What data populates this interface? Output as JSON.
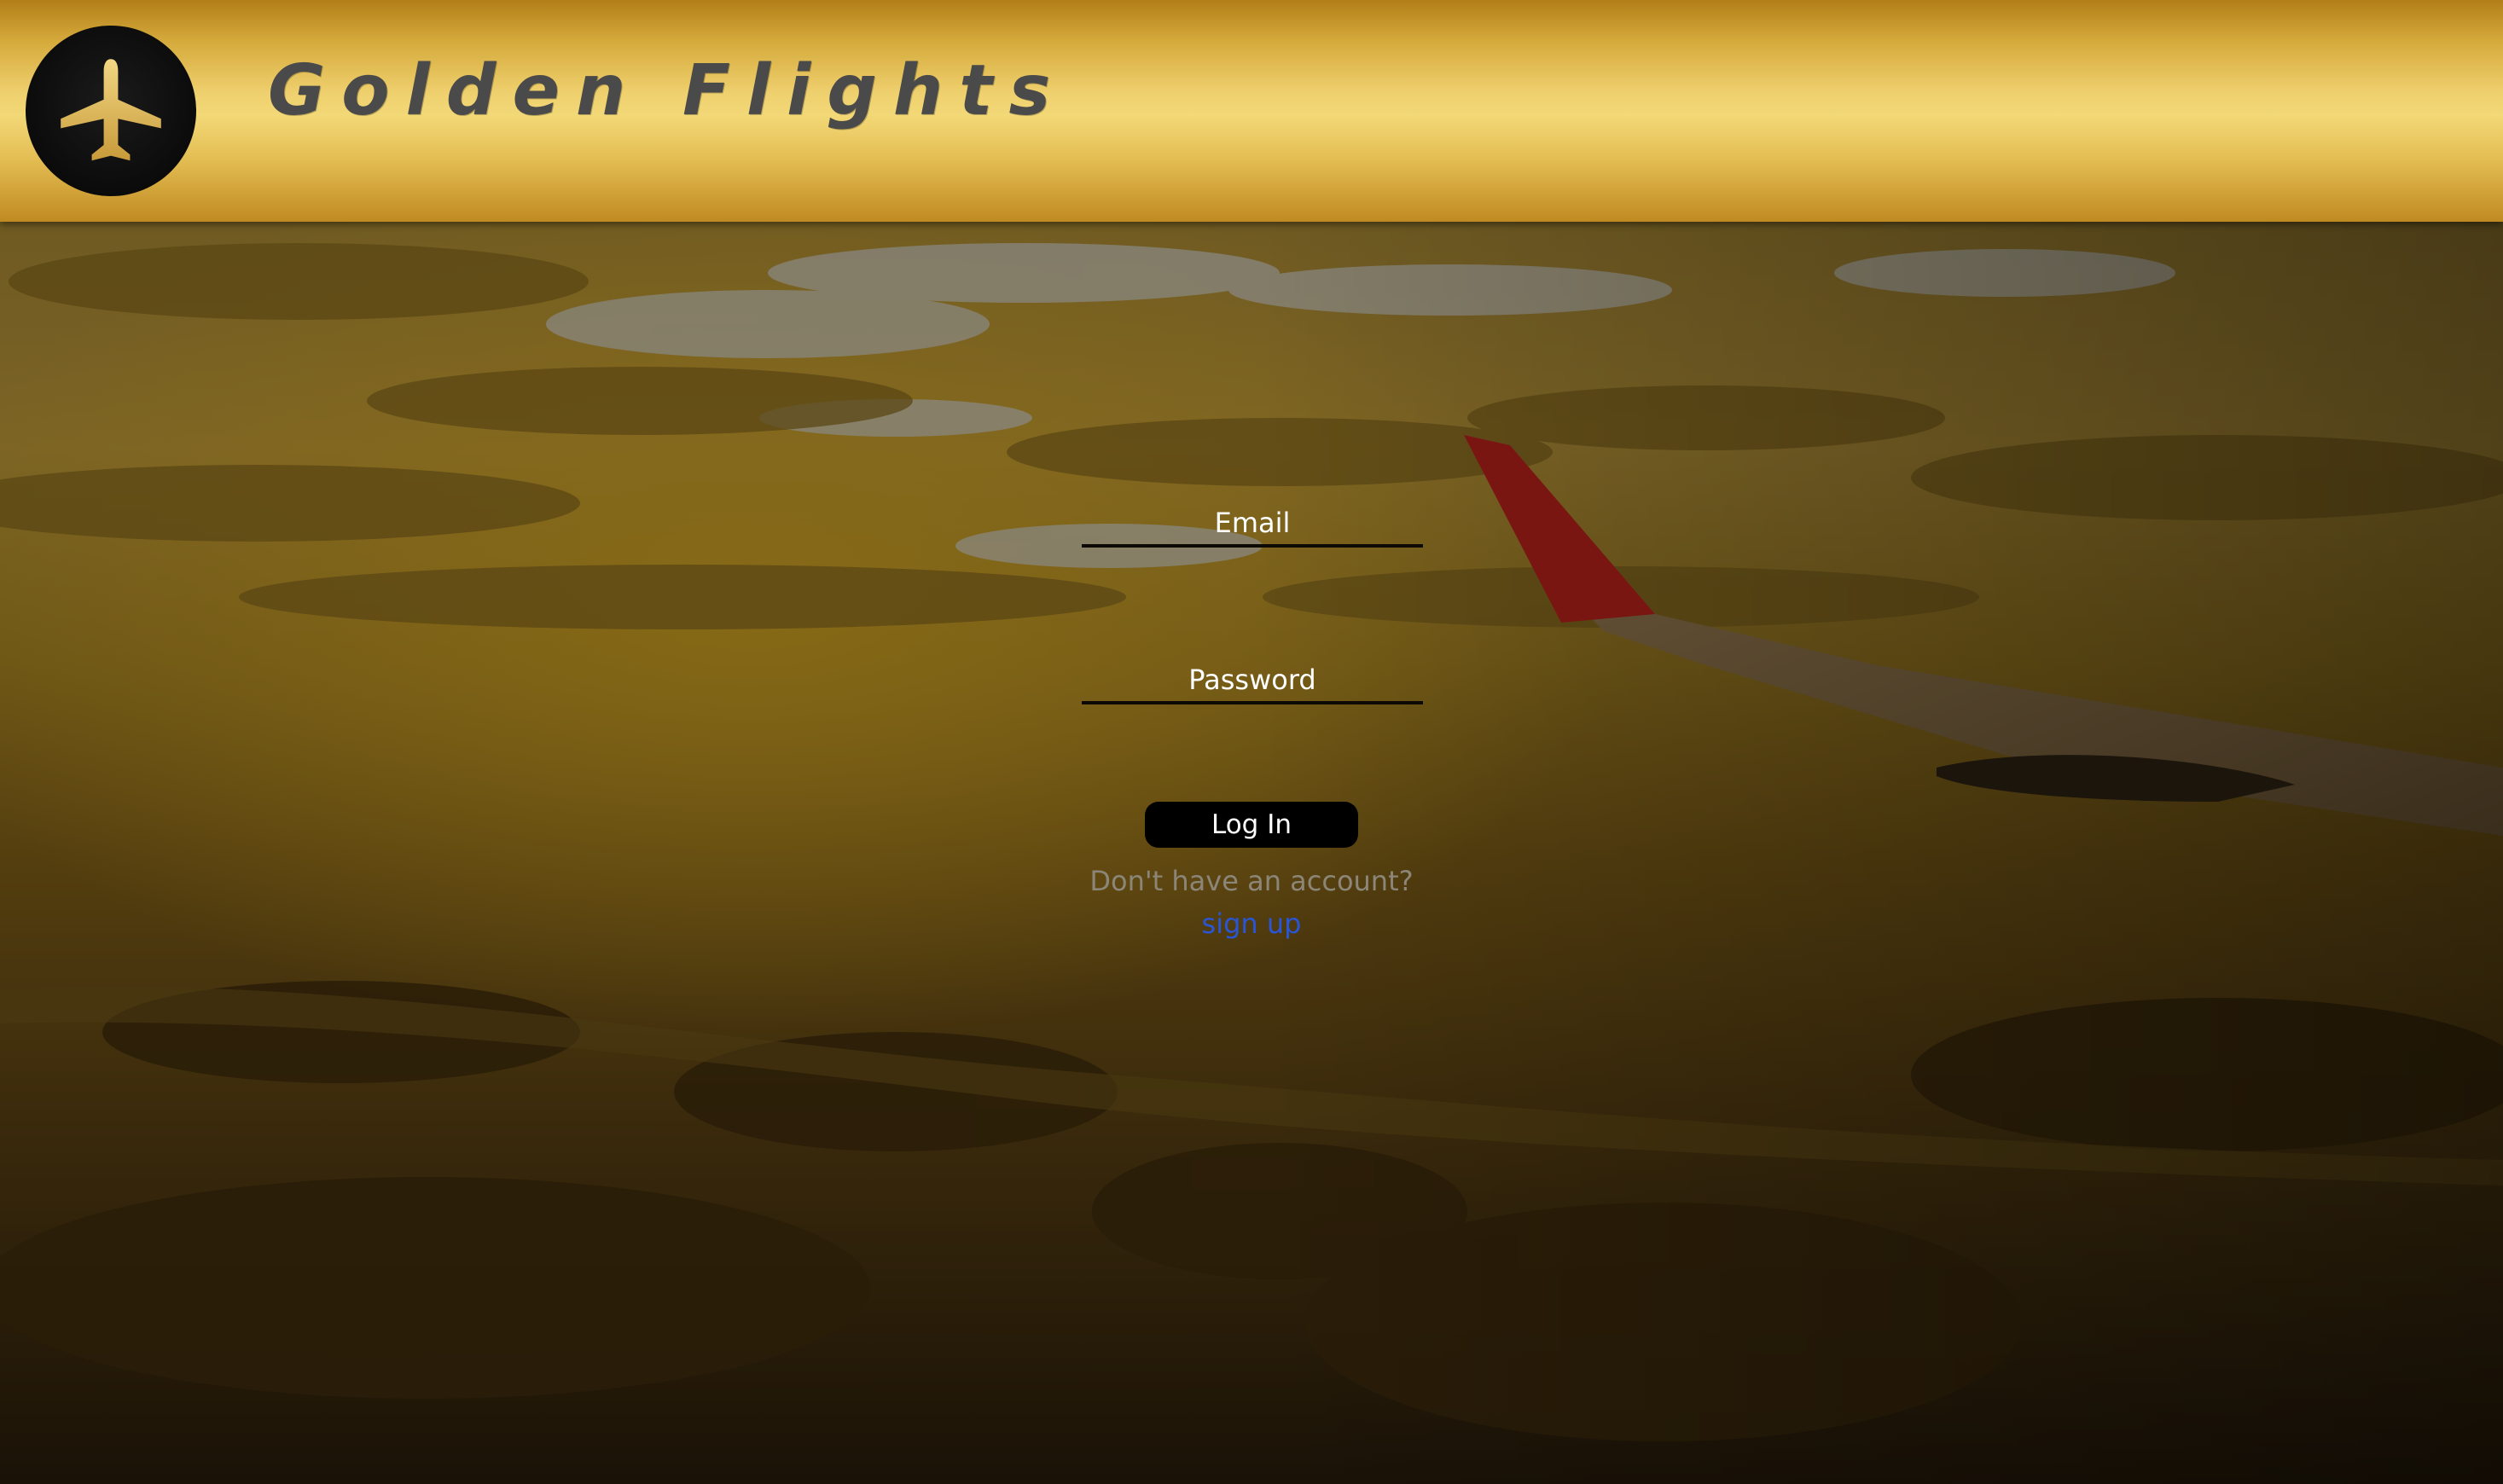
{
  "header": {
    "brand_title": "Golden Flights",
    "logo_icon": "airplane-icon"
  },
  "login_form": {
    "email_placeholder": "Email",
    "email_value": "",
    "password_placeholder": "Password",
    "password_value": "",
    "login_button_label": "Log In",
    "no_account_prompt": "Don't have an account?",
    "signup_link_label": "sign up"
  },
  "background": {
    "image_icon": "airplane-wing-sunset-photo"
  },
  "colors": {
    "header_gold": "#efd06e",
    "header_dark_gold": "#b27e18",
    "brand_text": "#4a4a4a",
    "link_blue": "#2a56d6",
    "prompt_gray": "#8c8678",
    "button_black": "#000000"
  }
}
